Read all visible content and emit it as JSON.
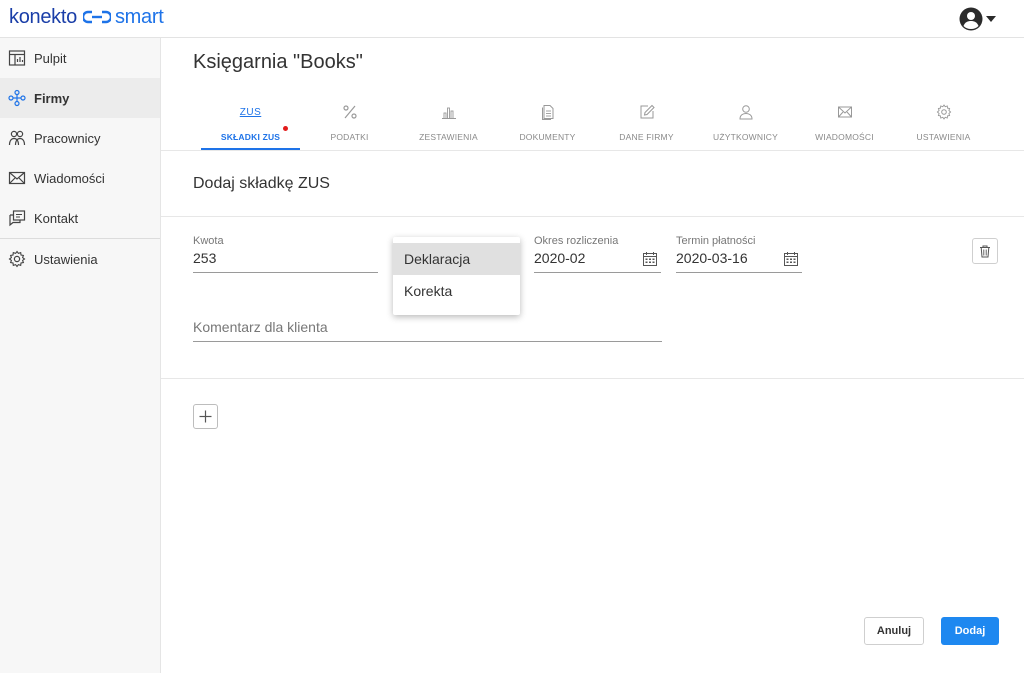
{
  "app": {
    "brand_left": "konekto",
    "brand_right": "smart",
    "brand_color": "#1a3ea8",
    "accent": "#1e73e8"
  },
  "sidebar": {
    "items": [
      {
        "label": "Pulpit",
        "icon": "dashboard-icon"
      },
      {
        "label": "Firmy",
        "icon": "companies-icon",
        "active": true
      },
      {
        "label": "Pracownicy",
        "icon": "employees-icon"
      },
      {
        "label": "Wiadomości",
        "icon": "messages-icon"
      },
      {
        "label": "Kontakt",
        "icon": "contact-icon"
      },
      {
        "label": "Ustawienia",
        "icon": "settings-icon"
      }
    ]
  },
  "main": {
    "company_title": "Księgarnia \"Books\"",
    "tabs": [
      {
        "label": "SKŁADKI ZUS",
        "icon_text": "ZUS",
        "active": true,
        "notification": true
      },
      {
        "label": "PODATKI",
        "icon": "percent-icon"
      },
      {
        "label": "ZESTAWIENIA",
        "icon": "bar-chart-icon"
      },
      {
        "label": "DOKUMENTY",
        "icon": "documents-icon"
      },
      {
        "label": "DANE FIRMY",
        "icon": "edit-icon"
      },
      {
        "label": "UŻYTKOWNICY",
        "icon": "user-icon"
      },
      {
        "label": "WIADOMOŚCI",
        "icon": "mail-icon"
      },
      {
        "label": "USTAWIENIA",
        "icon": "gear-icon"
      }
    ],
    "section_title": "Dodaj składkę ZUS",
    "form": {
      "amount_label": "Kwota",
      "amount_value": "253",
      "period_label": "Okres rozliczenia",
      "period_value": "2020-02",
      "due_label": "Termin płatności",
      "due_value": "2020-03-16",
      "comment_placeholder": "Komentarz dla klienta",
      "type_options": [
        "Deklaracja",
        "Korekta"
      ],
      "type_selected": "Deklaracja"
    },
    "actions": {
      "cancel_label": "Anuluj",
      "submit_label": "Dodaj"
    }
  }
}
